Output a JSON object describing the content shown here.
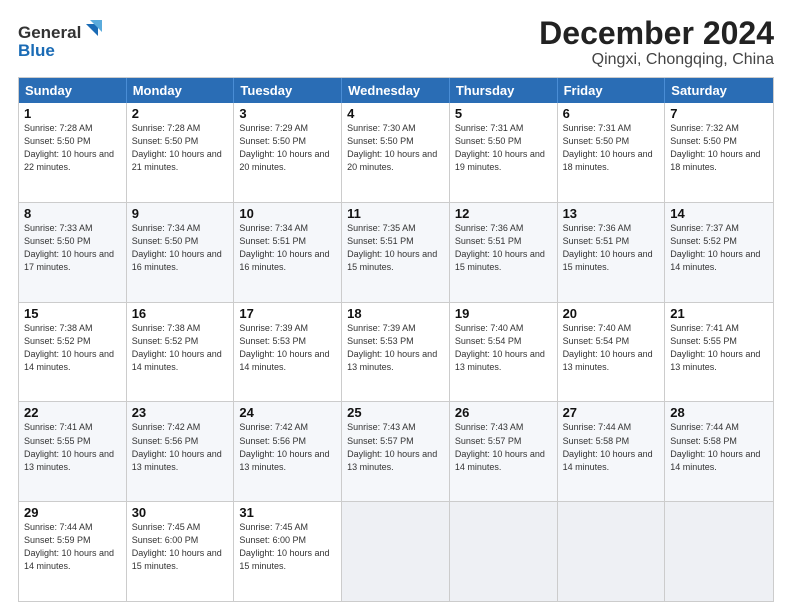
{
  "header": {
    "logo_text_general": "General",
    "logo_text_blue": "Blue",
    "month_title": "December 2024",
    "location": "Qingxi, Chongqing, China"
  },
  "calendar": {
    "days_of_week": [
      "Sunday",
      "Monday",
      "Tuesday",
      "Wednesday",
      "Thursday",
      "Friday",
      "Saturday"
    ],
    "weeks": [
      [
        {
          "day": "",
          "empty": true
        },
        {
          "day": "",
          "empty": true
        },
        {
          "day": "",
          "empty": true
        },
        {
          "day": "",
          "empty": true
        },
        {
          "day": "",
          "empty": true
        },
        {
          "day": "",
          "empty": true
        },
        {
          "day": "",
          "empty": true
        }
      ],
      [
        {
          "day": "1",
          "sunrise": "7:28 AM",
          "sunset": "5:50 PM",
          "daylight": "10 hours and 22 minutes."
        },
        {
          "day": "2",
          "sunrise": "7:28 AM",
          "sunset": "5:50 PM",
          "daylight": "10 hours and 21 minutes."
        },
        {
          "day": "3",
          "sunrise": "7:29 AM",
          "sunset": "5:50 PM",
          "daylight": "10 hours and 20 minutes."
        },
        {
          "day": "4",
          "sunrise": "7:30 AM",
          "sunset": "5:50 PM",
          "daylight": "10 hours and 20 minutes."
        },
        {
          "day": "5",
          "sunrise": "7:31 AM",
          "sunset": "5:50 PM",
          "daylight": "10 hours and 19 minutes."
        },
        {
          "day": "6",
          "sunrise": "7:31 AM",
          "sunset": "5:50 PM",
          "daylight": "10 hours and 18 minutes."
        },
        {
          "day": "7",
          "sunrise": "7:32 AM",
          "sunset": "5:50 PM",
          "daylight": "10 hours and 18 minutes."
        }
      ],
      [
        {
          "day": "8",
          "sunrise": "7:33 AM",
          "sunset": "5:50 PM",
          "daylight": "10 hours and 17 minutes."
        },
        {
          "day": "9",
          "sunrise": "7:34 AM",
          "sunset": "5:50 PM",
          "daylight": "10 hours and 16 minutes."
        },
        {
          "day": "10",
          "sunrise": "7:34 AM",
          "sunset": "5:51 PM",
          "daylight": "10 hours and 16 minutes."
        },
        {
          "day": "11",
          "sunrise": "7:35 AM",
          "sunset": "5:51 PM",
          "daylight": "10 hours and 15 minutes."
        },
        {
          "day": "12",
          "sunrise": "7:36 AM",
          "sunset": "5:51 PM",
          "daylight": "10 hours and 15 minutes."
        },
        {
          "day": "13",
          "sunrise": "7:36 AM",
          "sunset": "5:51 PM",
          "daylight": "10 hours and 15 minutes."
        },
        {
          "day": "14",
          "sunrise": "7:37 AM",
          "sunset": "5:52 PM",
          "daylight": "10 hours and 14 minutes."
        }
      ],
      [
        {
          "day": "15",
          "sunrise": "7:38 AM",
          "sunset": "5:52 PM",
          "daylight": "10 hours and 14 minutes."
        },
        {
          "day": "16",
          "sunrise": "7:38 AM",
          "sunset": "5:52 PM",
          "daylight": "10 hours and 14 minutes."
        },
        {
          "day": "17",
          "sunrise": "7:39 AM",
          "sunset": "5:53 PM",
          "daylight": "10 hours and 14 minutes."
        },
        {
          "day": "18",
          "sunrise": "7:39 AM",
          "sunset": "5:53 PM",
          "daylight": "10 hours and 13 minutes."
        },
        {
          "day": "19",
          "sunrise": "7:40 AM",
          "sunset": "5:54 PM",
          "daylight": "10 hours and 13 minutes."
        },
        {
          "day": "20",
          "sunrise": "7:40 AM",
          "sunset": "5:54 PM",
          "daylight": "10 hours and 13 minutes."
        },
        {
          "day": "21",
          "sunrise": "7:41 AM",
          "sunset": "5:55 PM",
          "daylight": "10 hours and 13 minutes."
        }
      ],
      [
        {
          "day": "22",
          "sunrise": "7:41 AM",
          "sunset": "5:55 PM",
          "daylight": "10 hours and 13 minutes."
        },
        {
          "day": "23",
          "sunrise": "7:42 AM",
          "sunset": "5:56 PM",
          "daylight": "10 hours and 13 minutes."
        },
        {
          "day": "24",
          "sunrise": "7:42 AM",
          "sunset": "5:56 PM",
          "daylight": "10 hours and 13 minutes."
        },
        {
          "day": "25",
          "sunrise": "7:43 AM",
          "sunset": "5:57 PM",
          "daylight": "10 hours and 13 minutes."
        },
        {
          "day": "26",
          "sunrise": "7:43 AM",
          "sunset": "5:57 PM",
          "daylight": "10 hours and 14 minutes."
        },
        {
          "day": "27",
          "sunrise": "7:44 AM",
          "sunset": "5:58 PM",
          "daylight": "10 hours and 14 minutes."
        },
        {
          "day": "28",
          "sunrise": "7:44 AM",
          "sunset": "5:58 PM",
          "daylight": "10 hours and 14 minutes."
        }
      ],
      [
        {
          "day": "29",
          "sunrise": "7:44 AM",
          "sunset": "5:59 PM",
          "daylight": "10 hours and 14 minutes."
        },
        {
          "day": "30",
          "sunrise": "7:45 AM",
          "sunset": "6:00 PM",
          "daylight": "10 hours and 15 minutes."
        },
        {
          "day": "31",
          "sunrise": "7:45 AM",
          "sunset": "6:00 PM",
          "daylight": "10 hours and 15 minutes."
        },
        {
          "day": "",
          "empty": true
        },
        {
          "day": "",
          "empty": true
        },
        {
          "day": "",
          "empty": true
        },
        {
          "day": "",
          "empty": true
        }
      ]
    ]
  }
}
